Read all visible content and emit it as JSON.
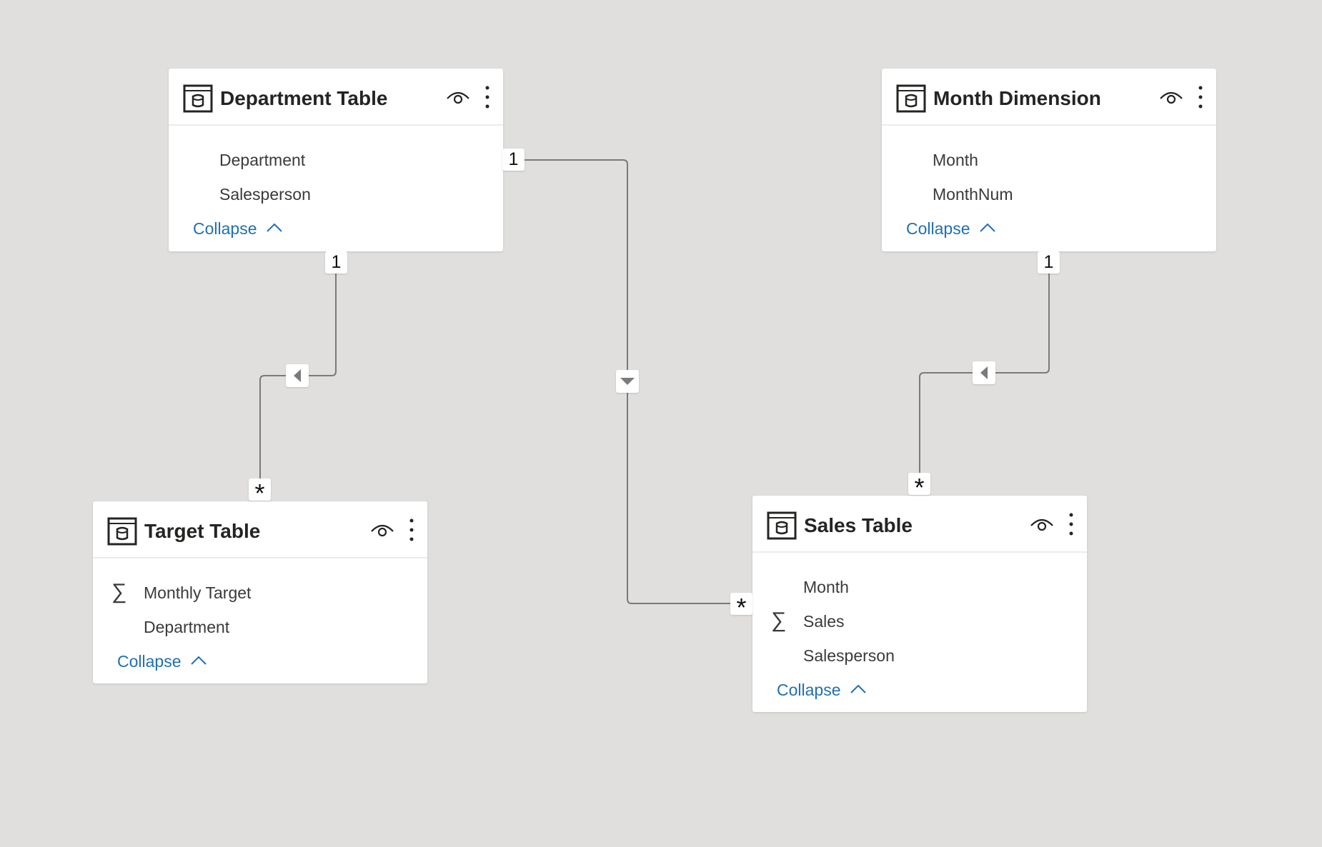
{
  "diagram": {
    "tables": [
      {
        "id": "department",
        "title": "Department Table",
        "fields": [
          {
            "name": "Department",
            "icon": ""
          },
          {
            "name": "Salesperson",
            "icon": ""
          }
        ],
        "collapse_label": "Collapse"
      },
      {
        "id": "month",
        "title": "Month Dimension",
        "fields": [
          {
            "name": "Month",
            "icon": ""
          },
          {
            "name": "MonthNum",
            "icon": ""
          }
        ],
        "collapse_label": "Collapse"
      },
      {
        "id": "target",
        "title": "Target Table",
        "fields": [
          {
            "name": "Monthly Target",
            "icon": "sigma-icon"
          },
          {
            "name": "Department",
            "icon": ""
          }
        ],
        "collapse_label": "Collapse"
      },
      {
        "id": "sales",
        "title": "Sales Table",
        "fields": [
          {
            "name": "Month",
            "icon": ""
          },
          {
            "name": "Sales",
            "icon": "sigma-icon"
          },
          {
            "name": "Salesperson",
            "icon": ""
          }
        ],
        "collapse_label": "Collapse"
      }
    ],
    "relationships": [
      {
        "from": "Department Table",
        "to": "Target Table",
        "from_cardinality": "1",
        "to_cardinality": "*",
        "filter_direction": "left"
      },
      {
        "from": "Department Table",
        "to": "Sales Table",
        "from_cardinality": "1",
        "to_cardinality": "*",
        "filter_direction": "down"
      },
      {
        "from": "Month Dimension",
        "to": "Sales Table",
        "from_cardinality": "1",
        "to_cardinality": "*",
        "filter_direction": "left"
      }
    ],
    "sigma_glyph": "∑",
    "colors": {
      "background": "#e0dfdd",
      "card": "#ffffff",
      "link": "#1f6fb4",
      "connector": "#7a7a7a"
    }
  }
}
